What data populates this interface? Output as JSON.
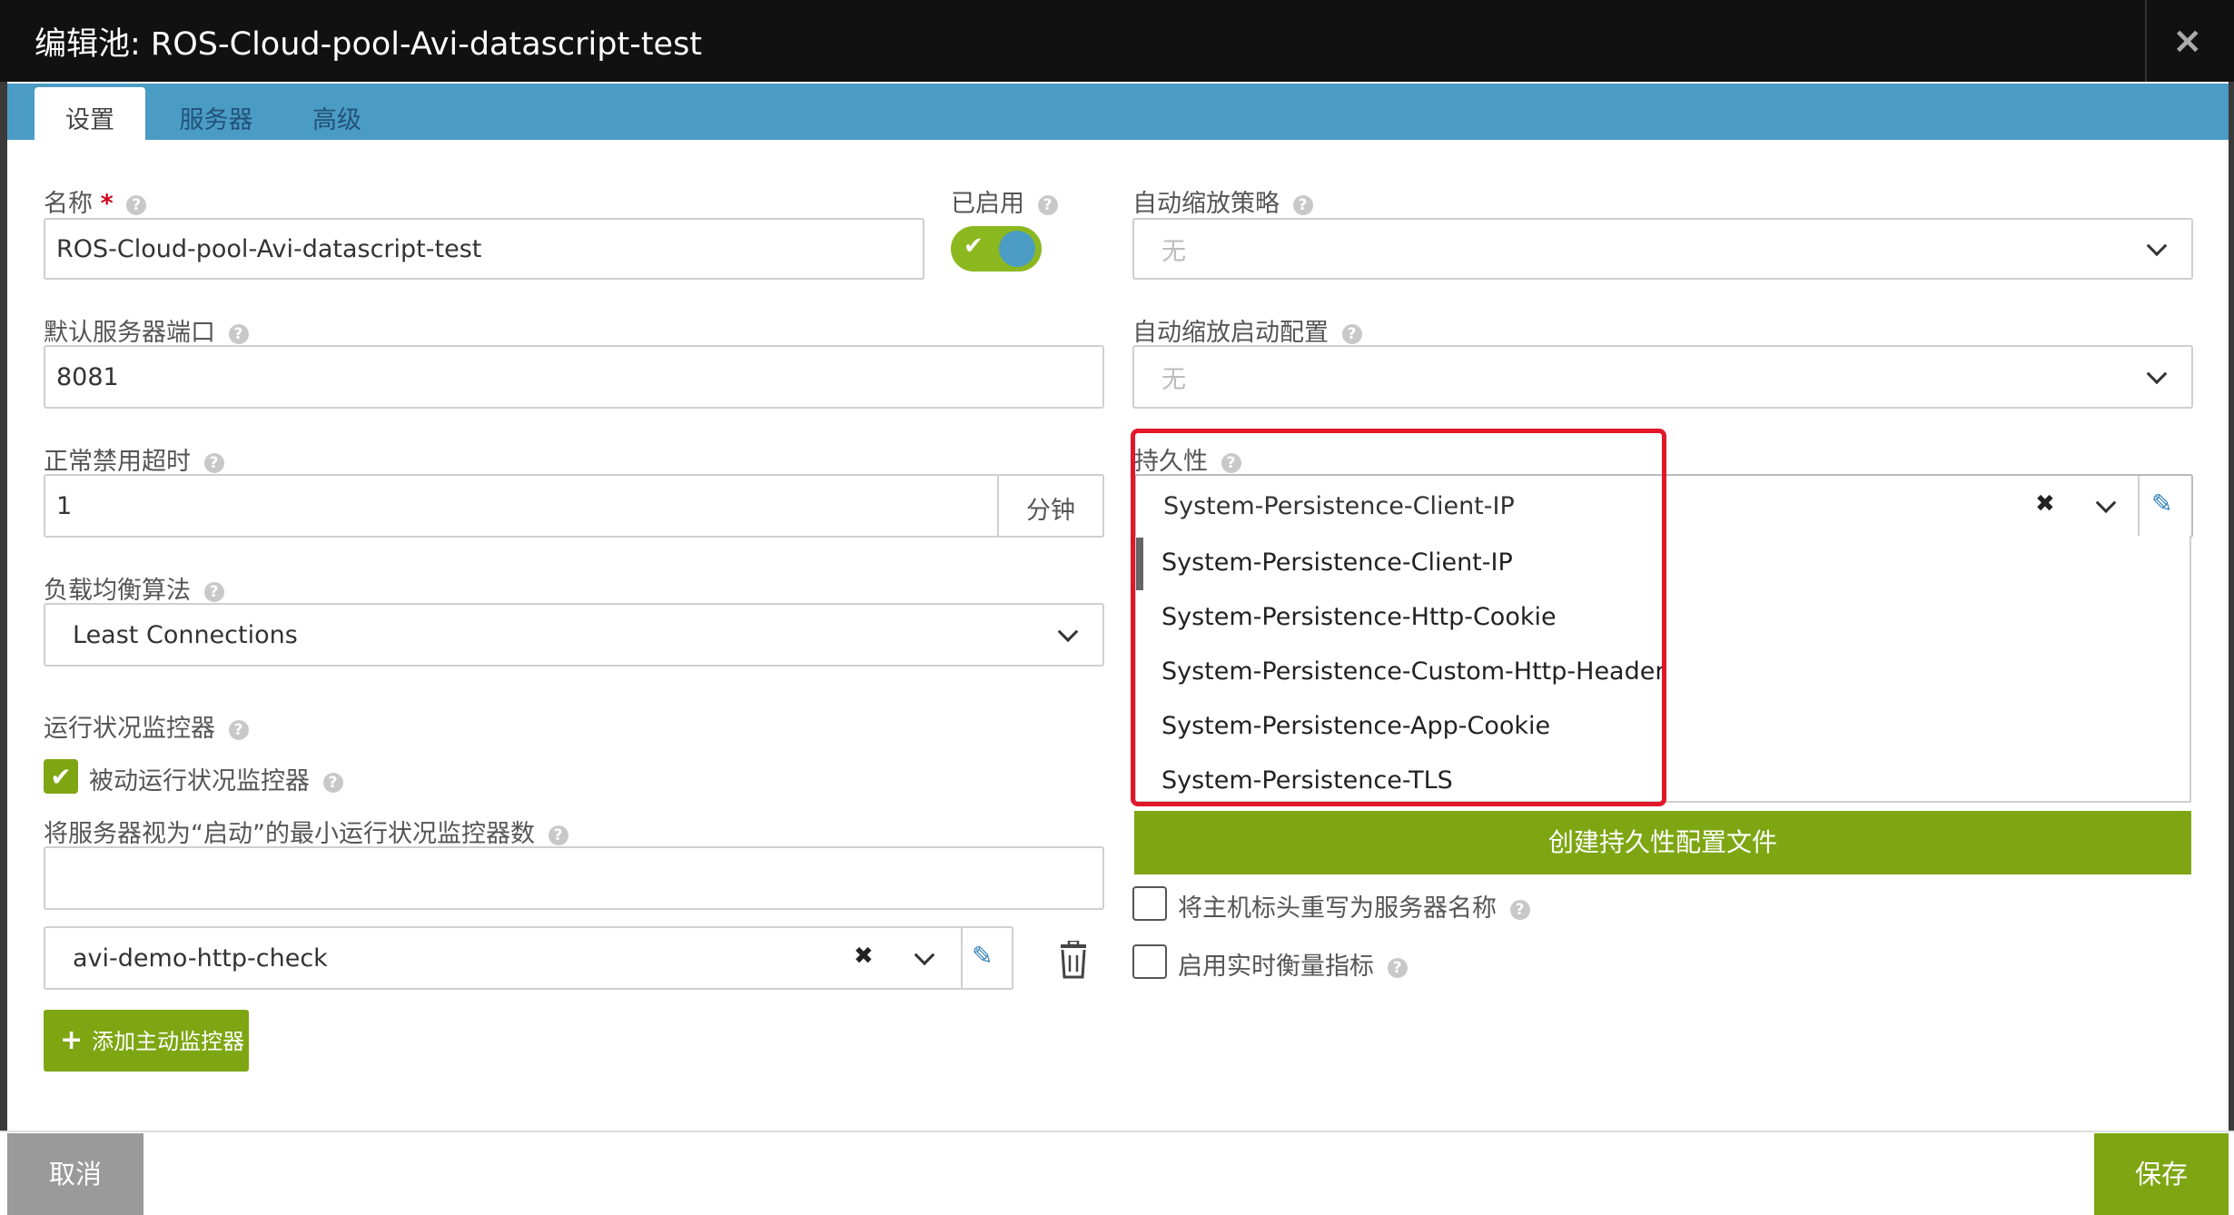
{
  "modal": {
    "title": "编辑池: ROS-Cloud-pool-Avi-datascript-test",
    "close_glyph": "×"
  },
  "tabs": [
    "设置",
    "服务器",
    "高级"
  ],
  "form": {
    "name": {
      "label": "名称",
      "required_mark": "*",
      "value": "ROS-Cloud-pool-Avi-datascript-test"
    },
    "enabled": {
      "label": "已启用",
      "value": true
    },
    "autoscale_policy": {
      "label": "自动缩放策略",
      "value": "无"
    },
    "default_port": {
      "label": "默认服务器端口",
      "value": "8081"
    },
    "autoscale_launch": {
      "label": "自动缩放启动配置",
      "value": "无"
    },
    "graceful_timeout": {
      "label": "正常禁用超时",
      "value": "1",
      "unit": "分钟"
    },
    "persistence": {
      "label": "持久性",
      "value": "System-Persistence-Client-IP",
      "options": [
        "System-Persistence-Client-IP",
        "System-Persistence-Http-Cookie",
        "System-Persistence-Custom-Http-Header",
        "System-Persistence-App-Cookie",
        "System-Persistence-TLS"
      ],
      "create_label": "创建持久性配置文件"
    },
    "lb_algorithm": {
      "label": "负载均衡算法",
      "value": "Least Connections"
    },
    "health_monitor": {
      "label": "运行状况监控器",
      "passive_label": "被动运行状况监控器",
      "passive_checked": true,
      "min_up_label": "将服务器视为“启动”的最小运行状况监控器数",
      "min_up_value": "",
      "monitor_value": "avi-demo-http-check",
      "add_label": "添加主动监控器"
    },
    "rewrite_host": {
      "label": "将主机标头重写为服务器名称",
      "checked": false
    },
    "realtime_metrics": {
      "label": "启用实时衡量指标",
      "checked": false
    }
  },
  "footer": {
    "cancel_label": "取消",
    "save_label": "保存"
  },
  "colors": {
    "accent_green": "#7ea613",
    "tab_blue": "#4a9cc4",
    "highlight_red": "#e1182a",
    "titlebar": "#111111"
  },
  "icons": [
    "help-icon",
    "check-icon",
    "chevron-down-icon",
    "clear-icon",
    "edit-pencil-icon",
    "trash-icon",
    "plus-icon",
    "close-icon"
  ]
}
